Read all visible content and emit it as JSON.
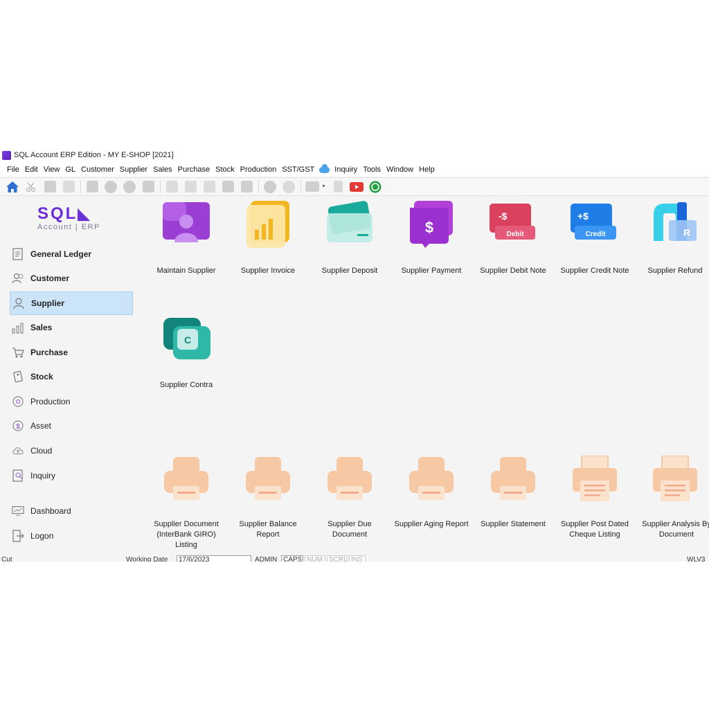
{
  "window": {
    "title": "SQL Account ERP Edition - MY E-SHOP [2021]"
  },
  "menu": [
    "File",
    "Edit",
    "View",
    "GL",
    "Customer",
    "Supplier",
    "Sales",
    "Purchase",
    "Stock",
    "Production",
    "SST/GST",
    "Inquiry",
    "Tools",
    "Window",
    "Help"
  ],
  "logo": {
    "main": "SQL",
    "sub": "Account | ERP"
  },
  "sidebar": {
    "items": [
      {
        "label": "General Ledger",
        "icon": "ledger-icon"
      },
      {
        "label": "Customer",
        "icon": "customer-icon"
      },
      {
        "label": "Supplier",
        "icon": "supplier-icon",
        "active": true
      },
      {
        "label": "Sales",
        "icon": "sales-icon"
      },
      {
        "label": "Purchase",
        "icon": "purchase-icon"
      },
      {
        "label": "Stock",
        "icon": "stock-icon"
      },
      {
        "label": "Production",
        "icon": "production-icon"
      },
      {
        "label": "Asset",
        "icon": "asset-icon"
      },
      {
        "label": "Cloud",
        "icon": "cloud-icon"
      },
      {
        "label": "Inquiry",
        "icon": "inquiry-icon"
      },
      {
        "label": "Dashboard",
        "icon": "dashboard-icon"
      },
      {
        "label": "Logon",
        "icon": "logon-icon"
      }
    ]
  },
  "tiles": {
    "maintain_supplier": "Maintain Supplier",
    "supplier_invoice": "Supplier Invoice",
    "supplier_deposit": "Supplier Deposit",
    "supplier_payment": "Supplier Payment",
    "supplier_debit_note": "Supplier Debit Note",
    "supplier_credit_note": "Supplier Credit Note",
    "supplier_refund": "Supplier Refund",
    "supplier_contra": "Supplier Contra",
    "debit_badge": "Debit",
    "credit_badge": "Credit",
    "debit_sign": "-$",
    "credit_sign": "+$",
    "payment_sign": "$",
    "contra_letter": "C",
    "refund_letter": "R"
  },
  "reports": {
    "r1_line1": "Supplier Document",
    "r1_line2": "(InterBank GIRO)",
    "r1_line3": "Listing",
    "r2_line1": "Supplier Balance",
    "r2_line2": "Report",
    "r3_line1": "Supplier Due",
    "r3_line2": "Document",
    "r4_line1": "Supplier Aging Report",
    "r5_line1": "Supplier Statement",
    "r6_line1": "Supplier Post Dated",
    "r6_line2": "Cheque Listing",
    "r7_line1": "Supplier Analysis By",
    "r7_line2": "Document"
  },
  "status": {
    "left": "Cut",
    "working_date_label": "Working Date",
    "working_date_value": "17/6/2023",
    "user": "ADMIN",
    "caps": "CAPS",
    "num": "NUM",
    "scrl": "SCRL",
    "ins": "INS",
    "version": "WLV3"
  },
  "colors": {
    "accent_purple": "#6b2fd8",
    "sidebar_active": "#cce4f7",
    "report_orange": "#f6c9a4"
  }
}
